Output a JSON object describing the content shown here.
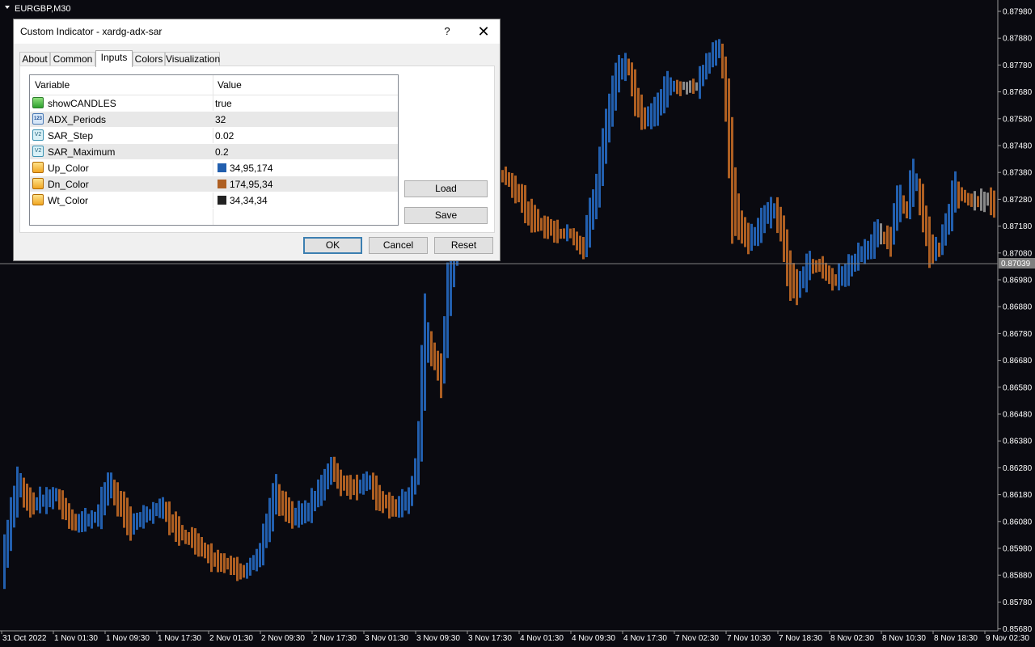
{
  "chart": {
    "symbol_label": "EURGBP,M30",
    "current_price": "0.87039",
    "price_axis": [
      "0.87980",
      "0.87880",
      "0.87780",
      "0.87680",
      "0.87580",
      "0.87480",
      "0.87380",
      "0.87280",
      "0.87180",
      "0.87080",
      "0.86980",
      "0.86880",
      "0.86780",
      "0.86680",
      "0.86580",
      "0.86480",
      "0.86380",
      "0.86280",
      "0.86180",
      "0.86080",
      "0.85980",
      "0.85880",
      "0.85780",
      "0.85680"
    ],
    "time_axis": [
      "31 Oct 2022",
      "1 Nov 01:30",
      "1 Nov 09:30",
      "1 Nov 17:30",
      "2 Nov 01:30",
      "2 Nov 09:30",
      "2 Nov 17:30",
      "3 Nov 01:30",
      "3 Nov 09:30",
      "3 Nov 17:30",
      "4 Nov 01:30",
      "4 Nov 09:30",
      "4 Nov 17:30",
      "7 Nov 02:30",
      "7 Nov 10:30",
      "7 Nov 18:30",
      "8 Nov 02:30",
      "8 Nov 10:30",
      "8 Nov 18:30",
      "9 Nov 02:30"
    ],
    "colors": {
      "background": "#0a0a10",
      "up": "#225fae",
      "down": "#ae5f22",
      "wait": "#8a8a8a",
      "axis_text": "#ffffff",
      "crosshair": "#808080"
    }
  },
  "dialog": {
    "title": "Custom Indicator - xardg-adx-sar",
    "help_label": "?",
    "close_glyph": "✕",
    "tabs": [
      {
        "label": "About",
        "active": false
      },
      {
        "label": "Common",
        "active": false
      },
      {
        "label": "Inputs",
        "active": true
      },
      {
        "label": "Colors",
        "active": false
      },
      {
        "label": "Visualization",
        "active": false
      }
    ],
    "grid_header": {
      "variable": "Variable",
      "value": "Value"
    },
    "params": [
      {
        "icon": "bool-icon",
        "name": "showCANDLES",
        "value": "true"
      },
      {
        "icon": "integer-icon",
        "name": "ADX_Periods",
        "value": "32",
        "icon_text": "123"
      },
      {
        "icon": "double-icon",
        "name": "SAR_Step",
        "value": "0.02",
        "icon_text": "V2"
      },
      {
        "icon": "double-icon",
        "name": "SAR_Maximum",
        "value": "0.2",
        "icon_text": "V2"
      },
      {
        "icon": "color-icon",
        "name": "Up_Color",
        "value": "34,95,174",
        "swatch": "#225fae"
      },
      {
        "icon": "color-icon",
        "name": "Dn_Color",
        "value": "174,95,34",
        "swatch": "#ae5f22"
      },
      {
        "icon": "color-icon",
        "name": "Wt_Color",
        "value": "34,34,34",
        "swatch": "#222222"
      }
    ],
    "buttons": {
      "load": "Load",
      "save": "Save",
      "ok": "OK",
      "cancel": "Cancel",
      "reset": "Reset"
    }
  }
}
